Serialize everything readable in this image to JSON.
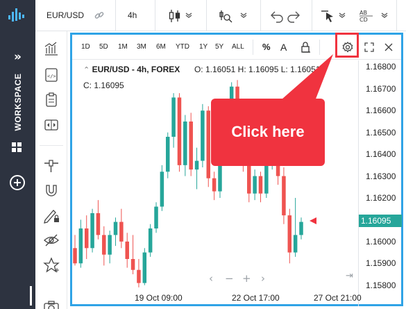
{
  "sidebar": {
    "logo_icon": "bar-chart-logo-icon",
    "expand_label": "»",
    "workspace_label": "WORKSPACE",
    "windows_icon": "windows-icon",
    "add_icon": "plus-circle-icon"
  },
  "toolbar": {
    "symbol": "EUR/USD",
    "interval": "4h",
    "icons": [
      "link-icon",
      "candles-icon",
      "indicators-icon",
      "undo-icon",
      "redo-icon",
      "cursor-icon",
      "text-tools-icon"
    ]
  },
  "chart_toolbar": {
    "timeframes": [
      "1D",
      "5D",
      "1M",
      "3M",
      "6M",
      "YTD",
      "1Y",
      "5Y",
      "ALL"
    ],
    "percent_label": "%",
    "auto_label": "A",
    "lock_icon": "lock-icon",
    "settings_icon": "gear-icon",
    "fullscreen_icon": "fullscreen-icon",
    "close_icon": "close-icon"
  },
  "legend": {
    "name": "EUR/USD - 4h, FOREX",
    "open": "O: 1.16051",
    "high": "H: 1.16095",
    "low": "L: 1.16051",
    "close": "C: 1.16095"
  },
  "callout": {
    "text": "Click here"
  },
  "chart_data": {
    "type": "candlestick",
    "y_ticks": [
      "1.16800",
      "1.16700",
      "1.16600",
      "1.16500",
      "1.16400",
      "1.16300",
      "1.16200",
      "1.16000",
      "1.15900",
      "1.15800"
    ],
    "ylim": [
      1.1578,
      1.1683
    ],
    "last_price": "1.16095",
    "x_ticks": [
      "19 Oct 09:00",
      "22 Oct 17:00",
      "27 Oct 21:00"
    ],
    "up_color": "#26a69a",
    "down_color": "#ef5350",
    "candles": [
      {
        "o": 1.1597,
        "h": 1.1603,
        "l": 1.1589,
        "c": 1.159
      },
      {
        "o": 1.159,
        "h": 1.161,
        "l": 1.1588,
        "c": 1.1606
      },
      {
        "o": 1.1606,
        "h": 1.1612,
        "l": 1.1592,
        "c": 1.1597
      },
      {
        "o": 1.1597,
        "h": 1.1615,
        "l": 1.1595,
        "c": 1.1613
      },
      {
        "o": 1.1613,
        "h": 1.1619,
        "l": 1.1601,
        "c": 1.1603
      },
      {
        "o": 1.1603,
        "h": 1.1607,
        "l": 1.1589,
        "c": 1.1594
      },
      {
        "o": 1.1594,
        "h": 1.1605,
        "l": 1.159,
        "c": 1.1603
      },
      {
        "o": 1.1603,
        "h": 1.1611,
        "l": 1.1598,
        "c": 1.1609
      },
      {
        "o": 1.1609,
        "h": 1.1615,
        "l": 1.1597,
        "c": 1.16
      },
      {
        "o": 1.16,
        "h": 1.1604,
        "l": 1.1588,
        "c": 1.1592
      },
      {
        "o": 1.1592,
        "h": 1.1603,
        "l": 1.1585,
        "c": 1.1587
      },
      {
        "o": 1.1587,
        "h": 1.1592,
        "l": 1.1579,
        "c": 1.1581
      },
      {
        "o": 1.1581,
        "h": 1.1597,
        "l": 1.158,
        "c": 1.1595
      },
      {
        "o": 1.1595,
        "h": 1.1608,
        "l": 1.1593,
        "c": 1.1606
      },
      {
        "o": 1.1606,
        "h": 1.1618,
        "l": 1.1604,
        "c": 1.1616
      },
      {
        "o": 1.1616,
        "h": 1.1635,
        "l": 1.1614,
        "c": 1.1632
      },
      {
        "o": 1.1632,
        "h": 1.165,
        "l": 1.1629,
        "c": 1.1648
      },
      {
        "o": 1.1648,
        "h": 1.1668,
        "l": 1.1643,
        "c": 1.1666
      },
      {
        "o": 1.1666,
        "h": 1.1668,
        "l": 1.1632,
        "c": 1.1635
      },
      {
        "o": 1.1635,
        "h": 1.1658,
        "l": 1.163,
        "c": 1.1655
      },
      {
        "o": 1.1655,
        "h": 1.1659,
        "l": 1.163,
        "c": 1.1633
      },
      {
        "o": 1.1633,
        "h": 1.1643,
        "l": 1.1624,
        "c": 1.1637
      },
      {
        "o": 1.1637,
        "h": 1.1663,
        "l": 1.1634,
        "c": 1.166
      },
      {
        "o": 1.166,
        "h": 1.1662,
        "l": 1.1625,
        "c": 1.1629
      },
      {
        "o": 1.1629,
        "h": 1.1632,
        "l": 1.1619,
        "c": 1.1623
      },
      {
        "o": 1.1623,
        "h": 1.1644,
        "l": 1.162,
        "c": 1.1641
      },
      {
        "o": 1.1641,
        "h": 1.1654,
        "l": 1.1638,
        "c": 1.1651
      },
      {
        "o": 1.1651,
        "h": 1.1673,
        "l": 1.1648,
        "c": 1.1671
      },
      {
        "o": 1.1671,
        "h": 1.1674,
        "l": 1.1646,
        "c": 1.1649
      },
      {
        "o": 1.1649,
        "h": 1.1653,
        "l": 1.1632,
        "c": 1.1635
      },
      {
        "o": 1.1635,
        "h": 1.164,
        "l": 1.1618,
        "c": 1.1622
      },
      {
        "o": 1.1622,
        "h": 1.1633,
        "l": 1.1619,
        "c": 1.163
      },
      {
        "o": 1.163,
        "h": 1.1632,
        "l": 1.1618,
        "c": 1.1622
      },
      {
        "o": 1.1622,
        "h": 1.1638,
        "l": 1.162,
        "c": 1.1635
      },
      {
        "o": 1.1635,
        "h": 1.165,
        "l": 1.1633,
        "c": 1.1645
      },
      {
        "o": 1.1645,
        "h": 1.1648,
        "l": 1.1626,
        "c": 1.163
      },
      {
        "o": 1.163,
        "h": 1.1634,
        "l": 1.1608,
        "c": 1.1612
      },
      {
        "o": 1.1612,
        "h": 1.1615,
        "l": 1.159,
        "c": 1.1595
      },
      {
        "o": 1.1595,
        "h": 1.162,
        "l": 1.1593,
        "c": 1.1603
      },
      {
        "o": 1.1603,
        "h": 1.1611,
        "l": 1.1601,
        "c": 1.1609
      }
    ]
  }
}
